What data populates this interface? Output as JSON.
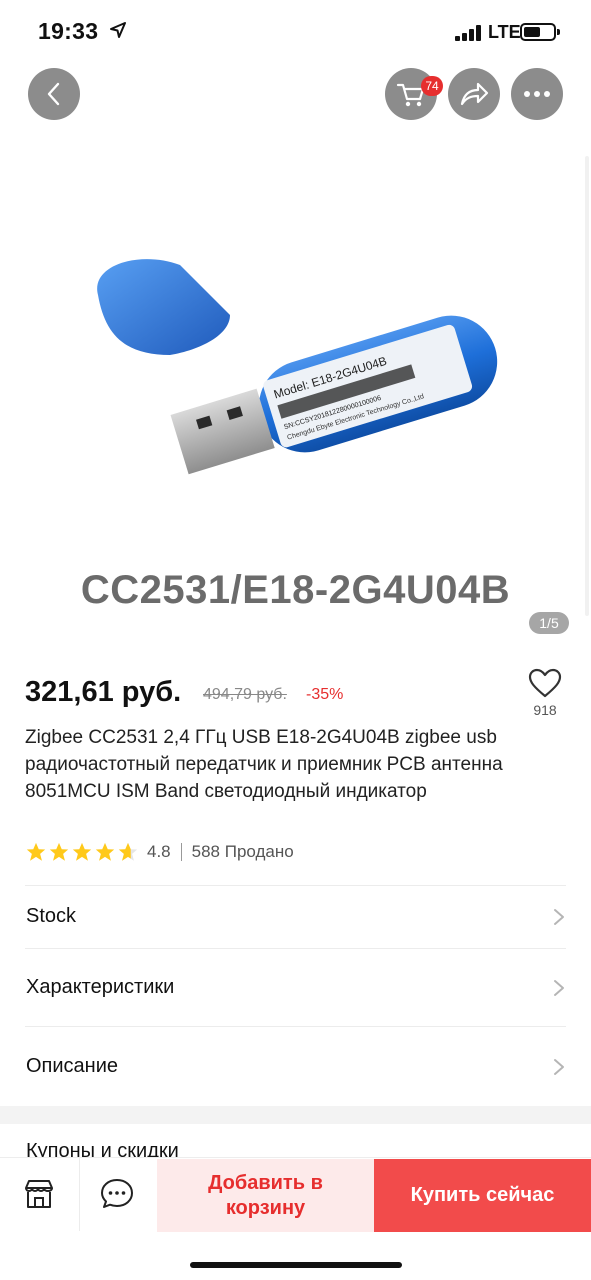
{
  "status_bar": {
    "time": "19:33",
    "network": "LTE"
  },
  "header": {
    "cart_count": "74"
  },
  "gallery": {
    "caption": "CC2531/E18-2G4U04B",
    "counter": "1/5",
    "label_model": "Model: E18-2G4U04B",
    "label_sn": "SN:CCSY201812280000100006",
    "label_maker": "Chengdu Ebyte Electronic Technology Co.,Ltd"
  },
  "product": {
    "price": "321,61 руб.",
    "old_price": "494,79 руб.",
    "discount": "-35%",
    "favorites": "918",
    "title": "Zigbee CC2531 2,4 ГГц USB E18-2G4U04B zigbee usb радиочастотный передатчик и приемник PCB антенна 8051MCU ISM Band светодиодный индикатор",
    "rating": "4.8",
    "rating_value": 4.8,
    "sold": "588 Продано"
  },
  "sections": [
    {
      "label": "Stock"
    },
    {
      "label": "Характеристики"
    },
    {
      "label": "Описание"
    }
  ],
  "coupons_label": "Купоны и скидки",
  "bottom_bar": {
    "add_to_cart": "Добавить в корзину",
    "buy_now": "Купить сейчас"
  },
  "colors": {
    "accent": "#e62e2e",
    "buy_button": "#f24b4b",
    "add_cart_bg": "#fdeaea",
    "star": "#ffc91a",
    "device_blue": "#1e6fd9"
  }
}
